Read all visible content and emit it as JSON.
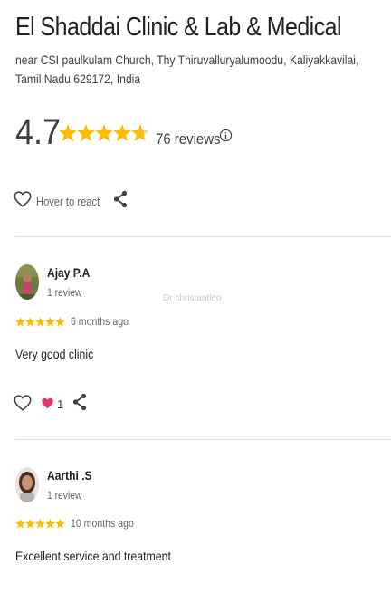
{
  "place": {
    "name": "El Shaddai Clinic & Lab & Medical",
    "address": "near CSI paulkulam Church, Thy Thiruvalluryalumoodu, Kaliyakkavilai, Tamil Nadu 629172, India",
    "rating": "4.7",
    "rating_value": 4.7,
    "reviews_count": "76 reviews"
  },
  "react": {
    "label": "Hover to react"
  },
  "watermark": "Dr christantleo",
  "reviews": [
    {
      "name": "Ajay P.A",
      "sub": "1 review",
      "stars": 5,
      "time": "6 months ago",
      "text": "Very good clinic",
      "reaction_count": "1"
    },
    {
      "name": "Aarthi .S",
      "sub": "1 review",
      "stars": 5,
      "time": "10 months ago",
      "text": "Excellent service and treatment"
    }
  ],
  "colors": {
    "star": "#fbbc04",
    "star_empty": "#dadce0",
    "heart_reaction": "#e8336e",
    "divider": "#dadce0"
  },
  "icons": [
    "star-icon",
    "info-icon",
    "heart-outline-icon",
    "share-icon",
    "heart-filled-icon"
  ]
}
